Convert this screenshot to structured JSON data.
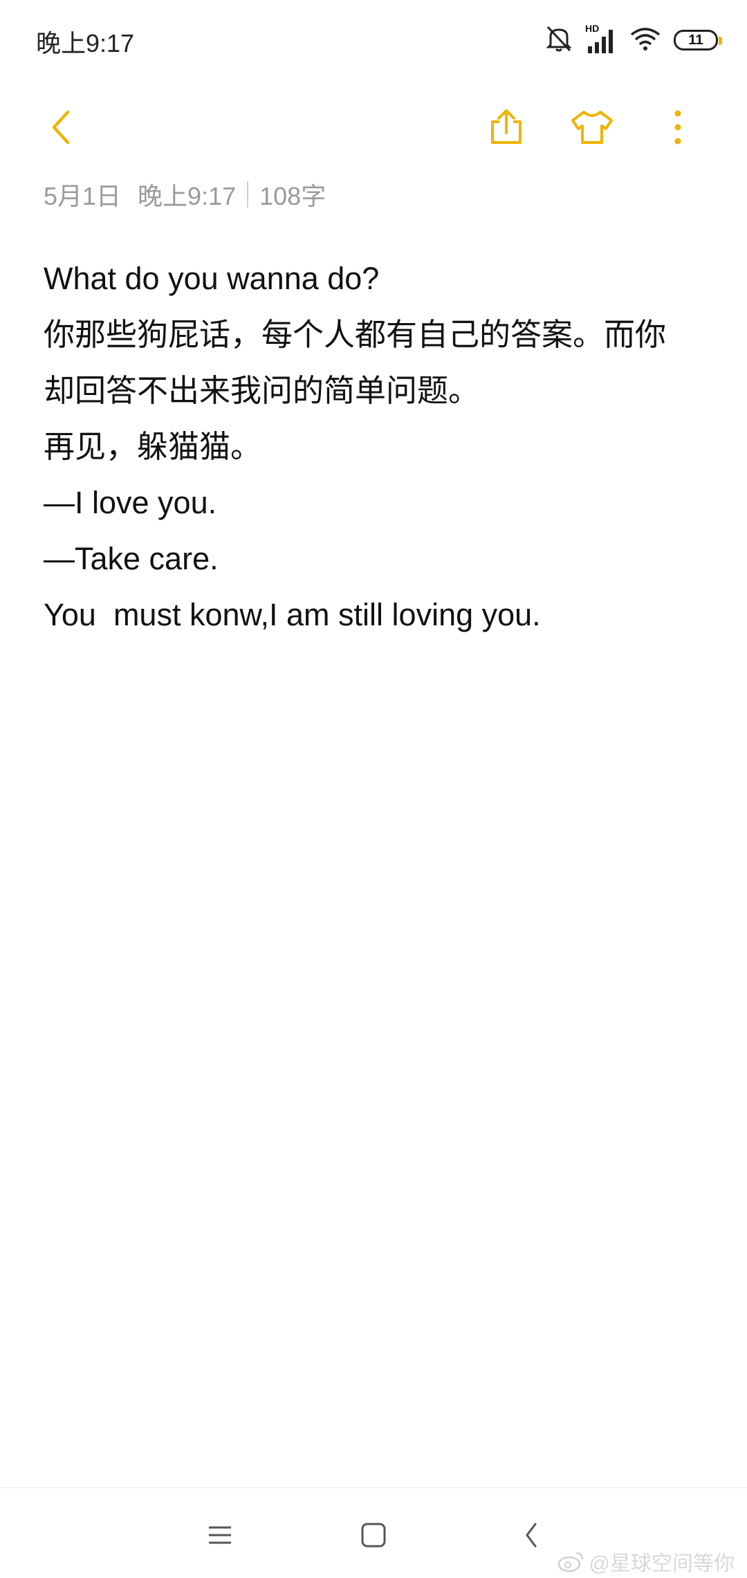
{
  "status_bar": {
    "time": "晚上9:17",
    "network_label": "HD",
    "battery_level": "11",
    "icons": [
      "bell-off-icon",
      "signal-icon",
      "wifi-icon",
      "battery-icon"
    ]
  },
  "toolbar": {
    "icons": [
      "back-icon",
      "share-icon",
      "theme-shirt-icon",
      "more-icon"
    ],
    "accent_color": "#f0b400"
  },
  "meta": {
    "date": "5月1日",
    "time": "晚上9:17",
    "word_count": "108字"
  },
  "note": {
    "lines": [
      "What do you wanna do?",
      "你那些狗屁话，每个人都有自己的答案。而你",
      "却回答不出来我问的简单问题。",
      "再见，躲猫猫。",
      "—I love you.",
      "—Take care.",
      "You  must konw,I am still loving you."
    ]
  },
  "nav_bar": {
    "icons": [
      "menu-icon",
      "home-icon",
      "back-nav-icon"
    ]
  },
  "watermark": {
    "text": "@星球空间等你",
    "icon": "weibo-icon"
  }
}
